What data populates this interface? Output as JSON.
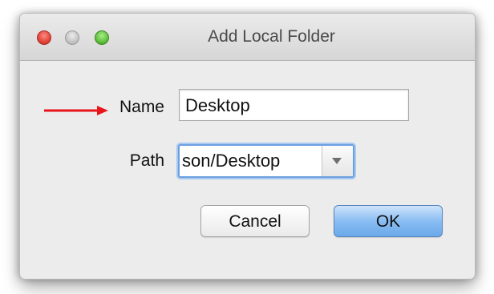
{
  "window": {
    "title": "Add Local Folder"
  },
  "form": {
    "name_label": "Name",
    "name_value": "Desktop",
    "path_label": "Path",
    "path_value": "son/Desktop"
  },
  "buttons": {
    "cancel_label": "Cancel",
    "ok_label": "OK"
  },
  "annotation": {
    "arrow_color": "#e8151b"
  },
  "colors": {
    "close": "#e0443a",
    "minimize": "#c4c4c4",
    "zoom": "#5fc13c",
    "focus_ring": "#6aa0e0",
    "default_button": "#89bdf2"
  }
}
